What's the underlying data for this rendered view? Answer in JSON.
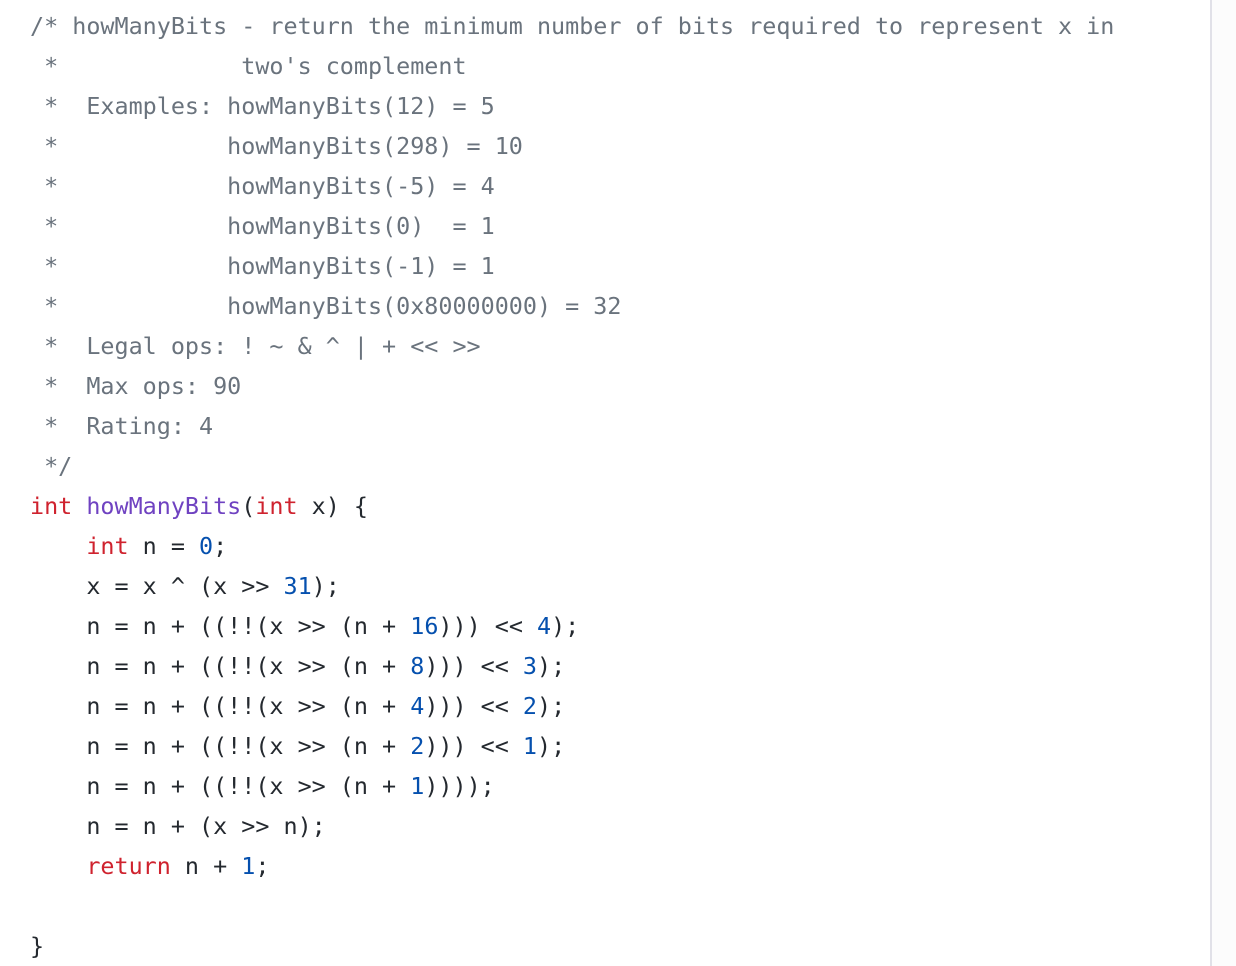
{
  "document": {
    "language": "c",
    "colors": {
      "comment": "#6a737d",
      "keyword": "#cf222e",
      "function": "#6f42c1",
      "number": "#0550ae",
      "plain": "#24292f",
      "background": "#ffffff",
      "gutter_border": "#e1e1e8"
    },
    "lines": [
      [
        {
          "t": "comment",
          "v": "/* howManyBits - return the minimum number of bits required to represent x in"
        }
      ],
      [
        {
          "t": "comment",
          "v": " *             two's complement"
        }
      ],
      [
        {
          "t": "comment",
          "v": " *  Examples: howManyBits(12) = 5"
        }
      ],
      [
        {
          "t": "comment",
          "v": " *            howManyBits(298) = 10"
        }
      ],
      [
        {
          "t": "comment",
          "v": " *            howManyBits(-5) = 4"
        }
      ],
      [
        {
          "t": "comment",
          "v": " *            howManyBits(0)  = 1"
        }
      ],
      [
        {
          "t": "comment",
          "v": " *            howManyBits(-1) = 1"
        }
      ],
      [
        {
          "t": "comment",
          "v": " *            howManyBits(0x80000000) = 32"
        }
      ],
      [
        {
          "t": "comment",
          "v": " *  Legal ops: ! ~ & ^ | + << >>"
        }
      ],
      [
        {
          "t": "comment",
          "v": " *  Max ops: 90"
        }
      ],
      [
        {
          "t": "comment",
          "v": " *  Rating: 4"
        }
      ],
      [
        {
          "t": "comment",
          "v": " */"
        }
      ],
      [
        {
          "t": "keyword",
          "v": "int"
        },
        {
          "t": "plain",
          "v": " "
        },
        {
          "t": "func",
          "v": "howManyBits"
        },
        {
          "t": "plain",
          "v": "("
        },
        {
          "t": "keyword",
          "v": "int"
        },
        {
          "t": "plain",
          "v": " x) {"
        }
      ],
      [
        {
          "t": "plain",
          "v": "    "
        },
        {
          "t": "keyword",
          "v": "int"
        },
        {
          "t": "plain",
          "v": " n = "
        },
        {
          "t": "number",
          "v": "0"
        },
        {
          "t": "plain",
          "v": ";"
        }
      ],
      [
        {
          "t": "plain",
          "v": "    x = x ^ (x >> "
        },
        {
          "t": "number",
          "v": "31"
        },
        {
          "t": "plain",
          "v": ");"
        }
      ],
      [
        {
          "t": "plain",
          "v": "    n = n + ((!!(x >> (n + "
        },
        {
          "t": "number",
          "v": "16"
        },
        {
          "t": "plain",
          "v": "))) << "
        },
        {
          "t": "number",
          "v": "4"
        },
        {
          "t": "plain",
          "v": ");"
        }
      ],
      [
        {
          "t": "plain",
          "v": "    n = n + ((!!(x >> (n + "
        },
        {
          "t": "number",
          "v": "8"
        },
        {
          "t": "plain",
          "v": "))) << "
        },
        {
          "t": "number",
          "v": "3"
        },
        {
          "t": "plain",
          "v": ");"
        }
      ],
      [
        {
          "t": "plain",
          "v": "    n = n + ((!!(x >> (n + "
        },
        {
          "t": "number",
          "v": "4"
        },
        {
          "t": "plain",
          "v": "))) << "
        },
        {
          "t": "number",
          "v": "2"
        },
        {
          "t": "plain",
          "v": ");"
        }
      ],
      [
        {
          "t": "plain",
          "v": "    n = n + ((!!(x >> (n + "
        },
        {
          "t": "number",
          "v": "2"
        },
        {
          "t": "plain",
          "v": "))) << "
        },
        {
          "t": "number",
          "v": "1"
        },
        {
          "t": "plain",
          "v": ");"
        }
      ],
      [
        {
          "t": "plain",
          "v": "    n = n + ((!!(x >> (n + "
        },
        {
          "t": "number",
          "v": "1"
        },
        {
          "t": "plain",
          "v": "))));"
        }
      ],
      [
        {
          "t": "plain",
          "v": "    n = n + (x >> n);"
        }
      ],
      [
        {
          "t": "plain",
          "v": "    "
        },
        {
          "t": "keyword",
          "v": "return"
        },
        {
          "t": "plain",
          "v": " n + "
        },
        {
          "t": "number",
          "v": "1"
        },
        {
          "t": "plain",
          "v": ";"
        }
      ],
      [
        {
          "t": "plain",
          "v": ""
        }
      ],
      [
        {
          "t": "plain",
          "v": "}"
        }
      ]
    ]
  }
}
